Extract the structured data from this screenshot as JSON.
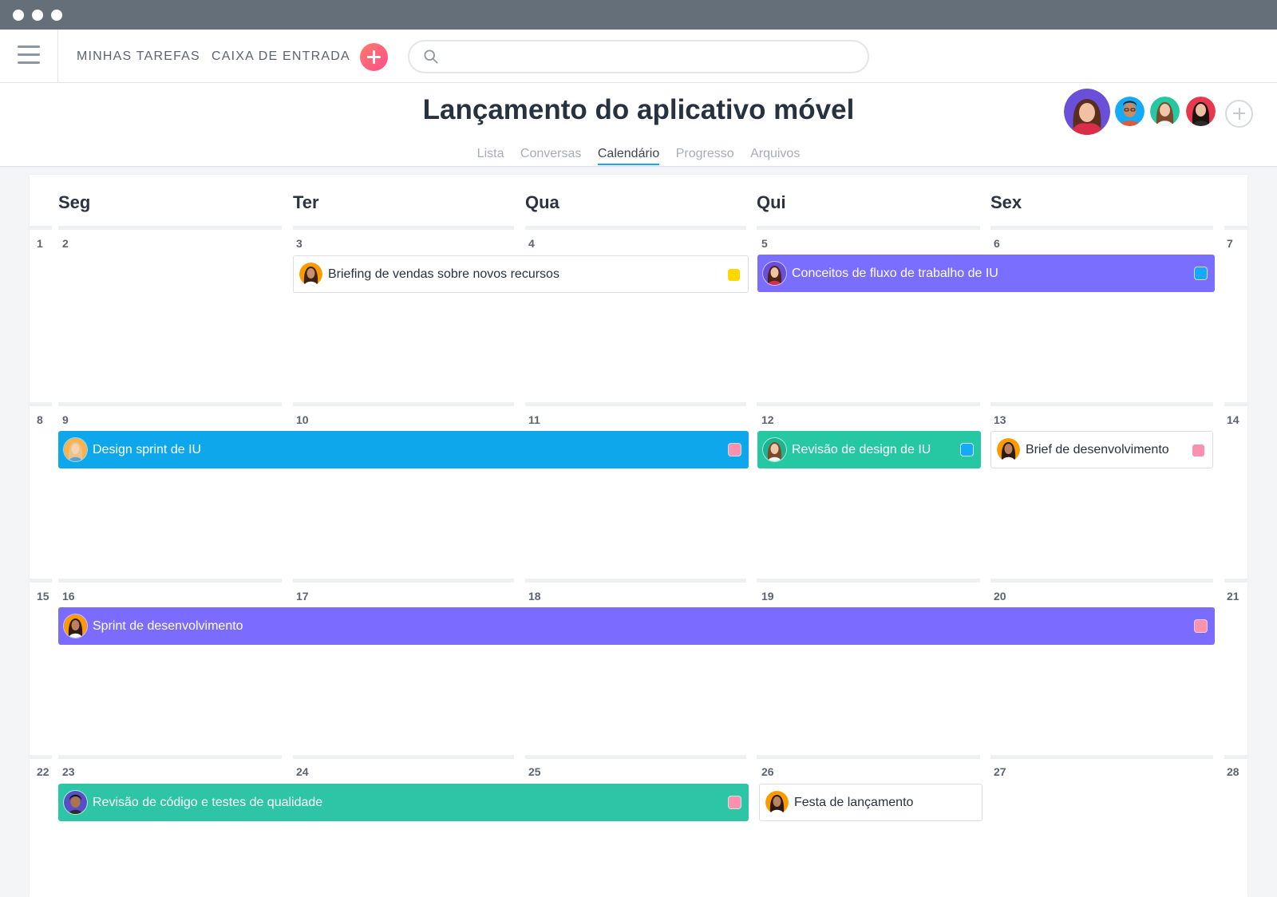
{
  "nav": {
    "my_tasks": "MINHAS TAREFAS",
    "inbox": "CAIXA DE ENTRADA",
    "search_placeholder": ""
  },
  "project": {
    "title": "Lançamento do aplicativo móvel",
    "tabs": [
      "Lista",
      "Conversas",
      "Calendário",
      "Progresso",
      "Arquivos"
    ],
    "active_tab": "Calendário"
  },
  "calendar": {
    "day_names": [
      "Seg",
      "Ter",
      "Qua",
      "Qui",
      "Sex"
    ],
    "weeks": [
      [
        "1",
        "2",
        "3",
        "4",
        "5",
        "6",
        "7"
      ],
      [
        "8",
        "9",
        "10",
        "11",
        "12",
        "13",
        "14"
      ],
      [
        "15",
        "16",
        "17",
        "18",
        "19",
        "20",
        "21"
      ],
      [
        "22",
        "23",
        "24",
        "25",
        "26",
        "27",
        "28"
      ]
    ]
  },
  "events": [
    {
      "label": "Briefing de vendas sobre novos recursos",
      "style": "outline",
      "color": "#ffffff",
      "tag_color": "#fcd800",
      "avatar": "woman-dark-hair-orange-bg"
    },
    {
      "label": "Conceitos de fluxo de trabalho de IU",
      "style": "filled",
      "color": "#796eff",
      "tag_color": "#14aaf5",
      "avatar": "woman-dark-hair-purple-bg"
    },
    {
      "label": "Design sprint de IU",
      "style": "filled",
      "color": "#14aaf5",
      "tag_color": "#fc91ad",
      "avatar": "woman-blonde-orange-bg"
    },
    {
      "label": "Revisão de design de IU",
      "style": "filled",
      "color": "#26c7a3",
      "tag_color": "#14aaf5",
      "avatar": "woman-long-hair-teal-bg"
    },
    {
      "label": "Brief de desenvolvimento",
      "style": "outline",
      "color": "#ffffff",
      "tag_color": "#fc91ad",
      "avatar": "woman-curly-hair-orange-bg"
    },
    {
      "label": "Sprint de desenvolvimento",
      "style": "filled",
      "color": "#796eff",
      "tag_color": "#fc91ad",
      "avatar": "woman-curly-hair-orange-bg"
    },
    {
      "label": "Revisão de código e testes de qualidade",
      "style": "filled",
      "color": "#2dc5a5",
      "tag_color": "#fc91ad",
      "avatar": "man-dark-hair-purple-bg"
    },
    {
      "label": "Festa de lançamento",
      "style": "outline",
      "color": "#ffffff",
      "tag_color": "",
      "avatar": "woman-curly-hair-orange-bg"
    }
  ],
  "members": [
    "woman-brown-hair-purple-bg",
    "man-glasses-blue-bg",
    "woman-long-hair-teal-bg",
    "woman-dark-hair-red-bg"
  ]
}
